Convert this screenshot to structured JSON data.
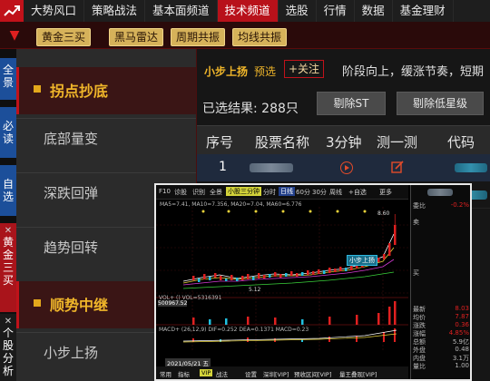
{
  "topnav": {
    "items": [
      "大势风口",
      "策略战法",
      "基本面频道",
      "技术频道",
      "选股",
      "行情",
      "数据",
      "基金理财"
    ],
    "active_index": 3
  },
  "subnav": {
    "tags": [
      "黄金三买",
      "黑马雷达",
      "周期共振",
      "均线共振"
    ]
  },
  "vtabs": {
    "items": [
      "全景",
      "必读",
      "自选",
      "黄金三买",
      "个股分析"
    ],
    "close_mark": "✕"
  },
  "strategies": {
    "groups": [
      {
        "title": "拐点抄底",
        "items": [
          "底部量变",
          "深跌回弹",
          "趋势回转"
        ]
      },
      {
        "title": "顺势中继",
        "items": [
          "小步上扬"
        ]
      }
    ]
  },
  "main": {
    "strategy_name": "小步上扬",
    "preselect_label": "预选",
    "follow_label": "+关注",
    "description": "阶段向上，缓涨节奏，短期",
    "selected_text": "已选结果: 288只",
    "buttons": [
      "剔除ST",
      "剔除低星级"
    ],
    "columns": [
      "序号",
      "股票名称",
      "3分钟",
      "测一测",
      "代码"
    ],
    "rows": [
      {
        "index": "1"
      }
    ]
  },
  "popup": {
    "toolbar": [
      "F10",
      "诊股",
      "识别",
      "全景",
      "小股三分钟",
      "分时",
      "日线",
      "60分",
      "30分",
      "周线",
      "+自选",
      "更多"
    ],
    "ma_text": "MA5=7.41, MA10=7.356, MA20=7.04, MA60=6.776",
    "callout": "小步上扬",
    "high_label": "8.60",
    "low_label": "5.12",
    "price_label": "500967.52",
    "vol_text": "VOL+ ()  VOL=5316391",
    "macd_text": "MACD+ (26,12,9)  DIF=0.252  DEA=0.1371  MACD=0.23",
    "date_label": "2021/05/21 五",
    "bottom_tabs": [
      "常用",
      "指标",
      "VIP",
      "战法",
      "设置",
      "深圳[VIP]",
      "预收区间[VIP]",
      "量王叠现[VIP]"
    ],
    "right_panel": {
      "rows": [
        {
          "k": "委比",
          "v": "-0.2%"
        },
        {
          "k": "卖",
          "v": ""
        },
        {
          "k": "买",
          "v": ""
        },
        {
          "k": "最新",
          "v": "8.03"
        },
        {
          "k": "均价",
          "v": "7.87"
        },
        {
          "k": "涨跌",
          "v": "0.36"
        },
        {
          "k": "涨幅",
          "v": "4.85%"
        },
        {
          "k": "总额",
          "v": "5.9亿"
        },
        {
          "k": "外盘",
          "v": "0.48"
        },
        {
          "k": "内盘",
          "v": "3.1万"
        },
        {
          "k": "量比",
          "v": "1.00"
        }
      ]
    }
  }
}
